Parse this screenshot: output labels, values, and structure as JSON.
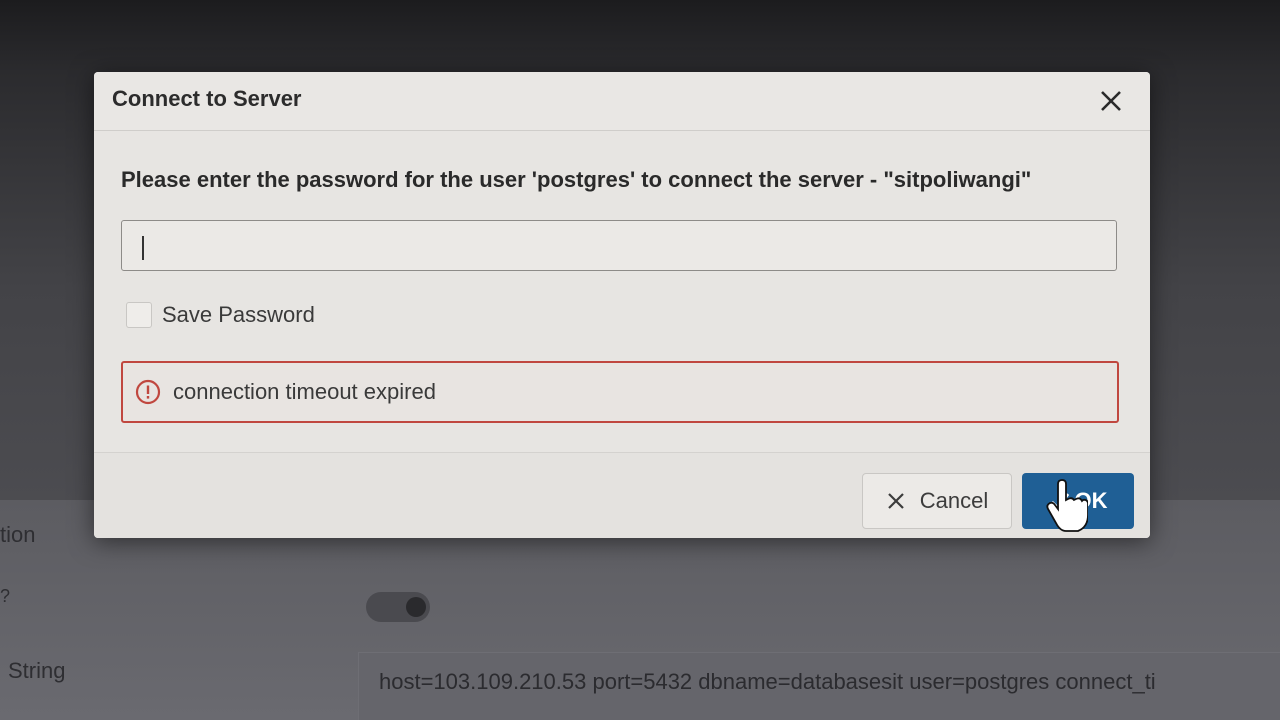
{
  "dialog": {
    "title": "Connect to Server",
    "prompt": "Please enter the password for the user 'postgres' to connect the server - \"sitpoliwangi\"",
    "password_value": "",
    "save_password_label": "Save Password",
    "save_password_checked": false,
    "error_message": "connection timeout expired",
    "cancel_label": "Cancel",
    "ok_label": "OK"
  },
  "background": {
    "partial_label": "tion",
    "partial_label_2": "?",
    "string_label": "String",
    "connection_string": "host=103.109.210.53 port=5432 dbname=databasesit user=postgres connect_ti"
  },
  "icons": {
    "close": "close-icon",
    "error": "error-circle-icon",
    "cancel": "x-icon",
    "ok": "check-icon",
    "cursor": "hand-pointer-icon"
  },
  "colors": {
    "primary": "#1f5f95",
    "error_border": "#c0473f",
    "dialog_bg": "#e7e5e2"
  }
}
